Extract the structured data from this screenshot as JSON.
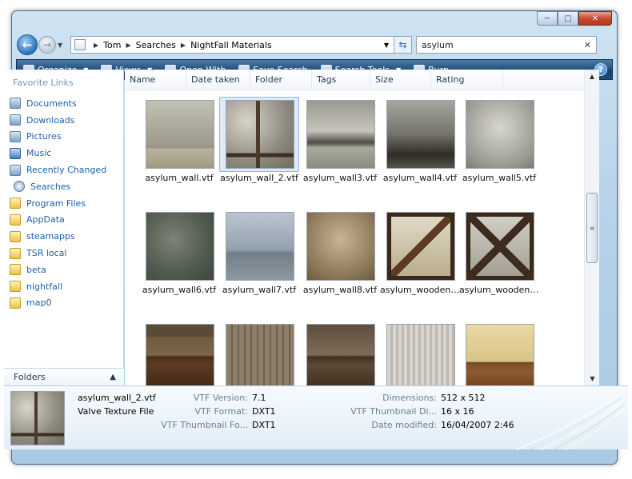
{
  "window": {
    "controls": {
      "minimize": "─",
      "maximize": "□",
      "close": "✕"
    }
  },
  "address_bar": {
    "breadcrumbs": [
      "Tom",
      "Searches",
      "NightFall Materials"
    ],
    "search_value": "asylum"
  },
  "toolbar": {
    "items": [
      {
        "label": "Organize",
        "icon": "organize-icon",
        "caret": true
      },
      {
        "label": "Views",
        "icon": "views-icon",
        "caret": true
      },
      {
        "label": "Open With",
        "icon": "open-with-icon",
        "caret": false
      },
      {
        "label": "Save Search",
        "icon": "save-search-icon",
        "caret": false
      },
      {
        "label": "Search Tools",
        "icon": "search-tools-icon",
        "caret": true
      },
      {
        "label": "Burn",
        "icon": "burn-icon",
        "caret": false
      }
    ],
    "help": "?"
  },
  "sidebar": {
    "header": "Favorite Links",
    "items": [
      {
        "label": "Documents",
        "icon": "doc"
      },
      {
        "label": "Downloads",
        "icon": "doc"
      },
      {
        "label": "Pictures",
        "icon": "doc"
      },
      {
        "label": "Music",
        "icon": "music"
      },
      {
        "label": "Recently Changed",
        "icon": "doc"
      },
      {
        "label": "Searches",
        "icon": "search"
      },
      {
        "label": "Program Files",
        "icon": "folder"
      },
      {
        "label": "AppData",
        "icon": "folder"
      },
      {
        "label": "steamapps",
        "icon": "folder"
      },
      {
        "label": "TSR local",
        "icon": "folder"
      },
      {
        "label": "beta",
        "icon": "folder"
      },
      {
        "label": "nightfall",
        "icon": "folder"
      },
      {
        "label": "map0",
        "icon": "folder"
      }
    ],
    "folders_label": "Folders"
  },
  "columns": [
    "Name",
    "Date taken",
    "Folder",
    "Tags",
    "Size",
    "Rating"
  ],
  "files": [
    {
      "name": "asylum_wall.vtf",
      "style": "plaster-grey",
      "selected": false
    },
    {
      "name": "asylum_wall_2.vtf",
      "style": "beam-cross",
      "selected": true
    },
    {
      "name": "asylum_wall3.vtf",
      "style": "plaster-stripe",
      "selected": false
    },
    {
      "name": "asylum_wall4.vtf",
      "style": "plaster-dark",
      "selected": false
    },
    {
      "name": "asylum_wall5.vtf",
      "style": "plaster-light",
      "selected": false
    },
    {
      "name": "asylum_wall6.vtf",
      "style": "stone-green",
      "selected": false
    },
    {
      "name": "asylum_wall7.vtf",
      "style": "concrete-blue",
      "selected": false
    },
    {
      "name": "asylum_wall8.vtf",
      "style": "plaster-tan",
      "selected": false
    },
    {
      "name": "asylum_woodent...",
      "style": "wood-frame",
      "selected": false
    },
    {
      "name": "asylum_woodent...",
      "style": "wood-x",
      "selected": false
    },
    {
      "name": "",
      "style": "wood-panel",
      "selected": false
    },
    {
      "name": "",
      "style": "wood-dirty",
      "selected": false
    },
    {
      "name": "",
      "style": "wood-panel2",
      "selected": false
    },
    {
      "name": "",
      "style": "wallpaper-grey",
      "selected": false
    },
    {
      "name": "",
      "style": "wallpaper-yellow",
      "selected": false
    }
  ],
  "details": {
    "name": "asylum_wall_2.vtf",
    "type": "Valve Texture File",
    "props_left": [
      {
        "key": "VTF Version:",
        "value": "7.1"
      },
      {
        "key": "VTF Format:",
        "value": "DXT1"
      },
      {
        "key": "VTF Thumbnail Fo...",
        "value": "DXT1"
      }
    ],
    "props_right": [
      {
        "key": "Dimensions:",
        "value": "512 x 512"
      },
      {
        "key": "VTF Thumbnail Di...",
        "value": "16 x 16"
      },
      {
        "key": "Date modified:",
        "value": "16/04/2007 2:46"
      }
    ]
  }
}
